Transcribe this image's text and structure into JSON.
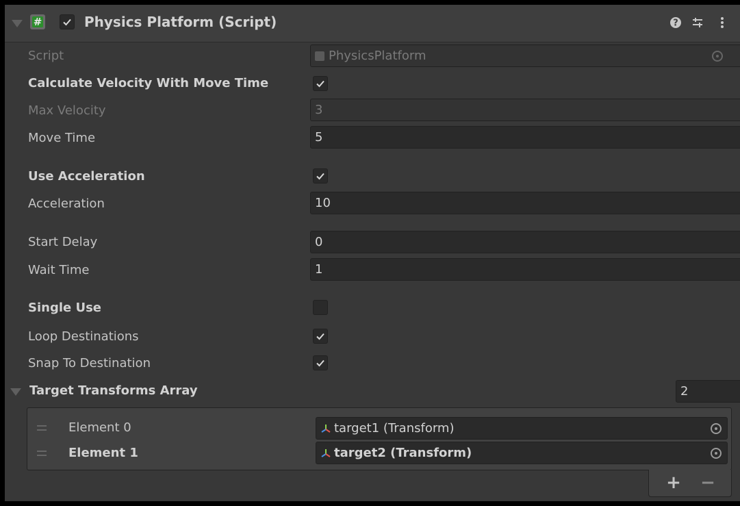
{
  "component": {
    "title": "Physics Platform (Script)",
    "enabled": true
  },
  "fields": {
    "script": {
      "label": "Script",
      "value": "PhysicsPlatform"
    },
    "calc_velocity": {
      "label": "Calculate Velocity With Move Time",
      "checked": true
    },
    "max_velocity": {
      "label": "Max Velocity",
      "value": "3"
    },
    "move_time": {
      "label": "Move Time",
      "value": "5"
    },
    "use_acceleration": {
      "label": "Use Acceleration",
      "checked": true
    },
    "acceleration": {
      "label": "Acceleration",
      "value": "10"
    },
    "start_delay": {
      "label": "Start Delay",
      "value": "0"
    },
    "wait_time": {
      "label": "Wait Time",
      "value": "1"
    },
    "single_use": {
      "label": "Single Use",
      "checked": false
    },
    "loop_destinations": {
      "label": "Loop Destinations",
      "checked": true
    },
    "snap_to_destination": {
      "label": "Snap To Destination",
      "checked": true
    }
  },
  "array": {
    "label": "Target Transforms Array",
    "size": "2",
    "elements": [
      {
        "label": "Element 0",
        "value": "target1 (Transform)"
      },
      {
        "label": "Element 1",
        "value": "target2 (Transform)"
      }
    ],
    "add_label": "+",
    "remove_label": "−"
  },
  "icons": {
    "script": "script-icon",
    "help": "help-icon",
    "presets": "presets-icon",
    "menu": "kebab-menu-icon",
    "transform": "transform-icon",
    "picker": "object-picker-icon"
  },
  "colors": {
    "background": "#383838",
    "field": "#2a2a2a",
    "script_icon_green": "#2c8e2c"
  }
}
